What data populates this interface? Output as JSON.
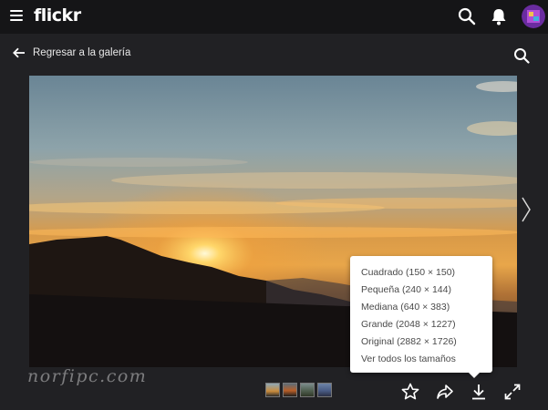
{
  "header": {
    "logo": "flickr",
    "icons": [
      "menu-icon",
      "search-icon",
      "bell-icon",
      "avatar"
    ]
  },
  "nav": {
    "back_label": "Regresar a la galería"
  },
  "download_menu": {
    "items": [
      "Cuadrado (150 × 150)",
      "Pequeña (240 × 144)",
      "Mediana (640 × 383)",
      "Grande (2048 × 1227)",
      "Original (2882 × 1726)",
      "Ver todos los tamaños"
    ]
  },
  "watermark": "norfipc.com",
  "toolbar": {
    "icons": [
      "star-icon",
      "share-icon",
      "download-icon",
      "expand-icon"
    ]
  },
  "colors": {
    "background": "#212124",
    "topbar": "#151517",
    "menu_text": "#4a4a4a"
  }
}
